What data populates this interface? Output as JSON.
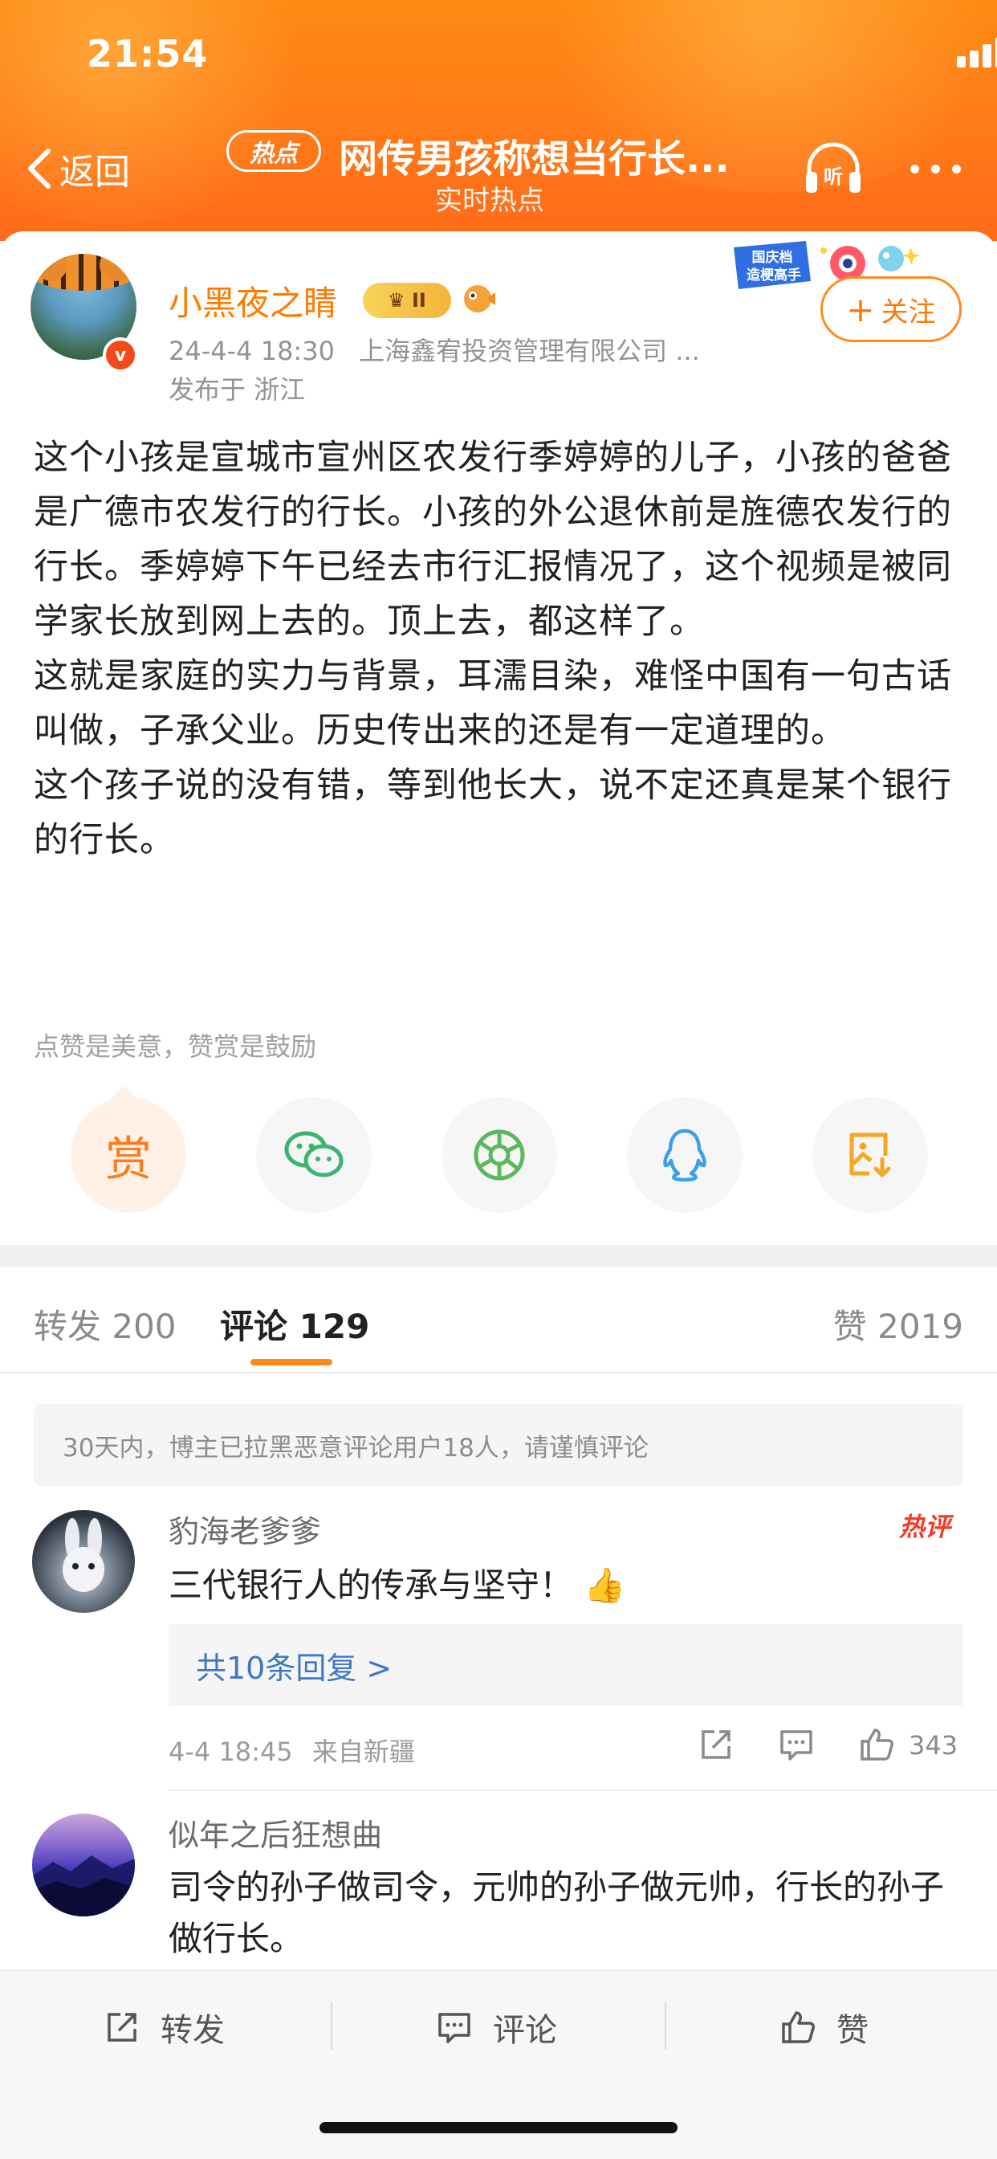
{
  "status_bar": {
    "time": "21:54"
  },
  "header": {
    "back_label": "返回",
    "hot_tag": "热点",
    "title": "网传男孩称想当行长...",
    "subtitle": "实时热点"
  },
  "post": {
    "author": {
      "name": "小黑夜之睛",
      "vip_level": "II",
      "verified_mark": "v"
    },
    "date": "24-4-4 18:30",
    "company": "上海鑫宥投资管理有限公司 ...",
    "location": "发布于 浙江",
    "promo_badge": "国庆档 造梗高手",
    "follow": {
      "plus": "+",
      "label": "关注"
    },
    "paragraphs": [
      "这个小孩是宣城市宣州区农发行季婷婷的儿子，小孩的爸爸是广德市农发行的行长。小孩的外公退休前是旌德农发行的行长。季婷婷下午已经去市行汇报情况了，这个视频是被同学家长放到网上去的。顶上去，都这样了。",
      "这就是家庭的实力与背景，耳濡目染，难怪中国有一句古话叫做，子承父业。历史传出来的还是有一定道理的。",
      "这个孩子说的没有错，等到他长大，说不定还真是某个银行的行长。"
    ],
    "reward_hint": "点赞是美意，赞赏是鼓励",
    "reward_label": "赏",
    "share_icons": [
      "wechat-icon",
      "moments-icon",
      "qq-icon",
      "save-image-icon"
    ]
  },
  "tabs": [
    {
      "label": "转发 200"
    },
    {
      "label": "评论 129",
      "active": true
    },
    {
      "label": "赞 2019"
    }
  ],
  "notice": "30天内，博主已拉黑恶意评论用户18人，请谨慎评论",
  "comments": [
    {
      "name": "豹海老爹爹",
      "text": "三代银行人的传承与坚守！",
      "emoji": "👍",
      "hot_tag": "热评",
      "replies": "共10条回复 >",
      "time": "4-4 18:45",
      "source": "来自新疆",
      "likes": "343"
    },
    {
      "name": "似年之后狂想曲",
      "text": "司令的孙子做司令，元帅的孙子做元帅，行长的孙子做行长。"
    }
  ],
  "bottom_bar": {
    "repost": "转发",
    "comment": "评论",
    "like": "赞"
  },
  "colors": {
    "brand_orange": "#ff7a18",
    "link_blue": "#3e78c4",
    "hot_red": "#f23b2a",
    "wechat_green": "#3cb371"
  }
}
